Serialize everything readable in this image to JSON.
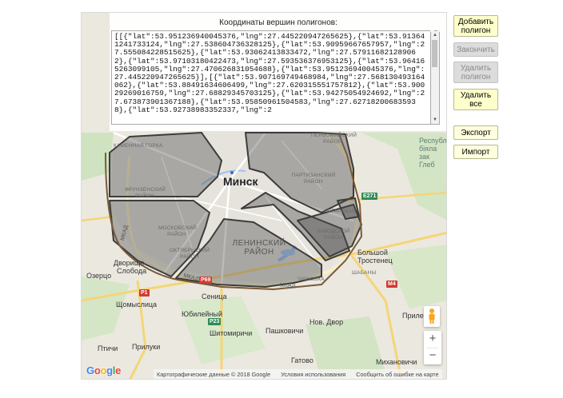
{
  "coords": {
    "title": "Координаты вершин полигонов:",
    "text": "[[{\"lat\":53.951236940045376,\"lng\":27.445220947265625},{\"lat\":53.913641241733124,\"lng\":27.538604736328125},{\"lat\":53.90959667657957,\"lng\":27.555084228515625},{\"lat\":53.93062413833472,\"lng\":27.579116821289062},{\"lat\":53.97103180422473,\"lng\":27.593536376953125},{\"lat\":53.964165263099105,\"lng\":27.470626831054688},{\"lat\":53.951236940045376,\"lng\":27.445220947265625}],[{\"lat\":53.907169749468984,\"lng\":27.568130493164062},{\"lat\":53.88491634606499,\"lng\":27.620315551757812},{\"lat\":53.90029269016759,\"lng\":27.68829345703125},{\"lat\":53.94275054924692,\"lng\":27.673873901367188},{\"lat\":53.95850961504583,\"lng\":27.627182006835938},{\"lat\":53.92738983352337,\"lng\":2"
  },
  "buttons": {
    "add_polygon": "Добавить полигон",
    "finish": "Закончить",
    "delete_polygon": "Удалить полигон",
    "delete_all": "Удалить все",
    "export": "Экспорт",
    "import": "Импорт"
  },
  "map": {
    "city": "Минск",
    "towns": {
      "kamennaya_gorka": "КАМЕННАЯ ГОРКА",
      "dvorishche": "Дворищe",
      "sloboda": "Слобода",
      "ozertso": "Озерцо",
      "senitsa": "Сеница",
      "shchomyslitsa": "Щомыслица",
      "yubileyny": "Юбилейный",
      "novy_dvor": "Нов. Двор",
      "pashkovichi": "Пашковичи",
      "shitomirichi": "Шитомиричи",
      "priluki": "Прилуки",
      "ptichi": "Птичи",
      "gatovo": "Гатово",
      "mikhanovichi": "Михановичи",
      "bolshoy_trostenets": "Большой Тростенец",
      "prile": "Приле",
      "shabany": "ШАБАНЫ",
      "chizhovka": "ЧИЖОВКА"
    },
    "districts": {
      "frunzensky": "ФРУНЗЕНСКИЙ РАЙОН",
      "moskovsky": "МОСКОВСКИЙ РАЙОН",
      "oktyabrsky": "ОКТЯБРЬСКИЙ РАЙОН",
      "leninsky": "ЛЕНИНСКИЙ РАЙОН",
      "partizansky": "ПАРТИЗАНСКИЙ РАЙОН",
      "pervomaysky": "ПЕРВОМАЙСКИЙ РАЙОН",
      "zavodskoy": "ЗАВОДСКОЙ РАЙОН",
      "angarskaya": "АНГАРСКАЯ",
      "mkad_left": "МКАД",
      "mkad_bottom": "МКАД",
      "mkad_bottom2": "МКАД"
    },
    "edge_text": "Республ\nбіяла\nзак\nГлеб",
    "shields": {
      "p1": "P1",
      "p69": "P69",
      "p23": "P23",
      "m4": "M4",
      "e271": "E271"
    },
    "google": [
      "G",
      "o",
      "o",
      "g",
      "l",
      "e"
    ],
    "google_colors": [
      "#4285F4",
      "#EA4335",
      "#FBBC05",
      "#4285F4",
      "#34A853",
      "#EA4335"
    ],
    "attribution": {
      "data": "Картографические данные © 2018 Google",
      "terms": "Условия использования",
      "report": "Сообщить об ошибке на карте"
    },
    "zoom_in": "+",
    "zoom_out": "−"
  }
}
